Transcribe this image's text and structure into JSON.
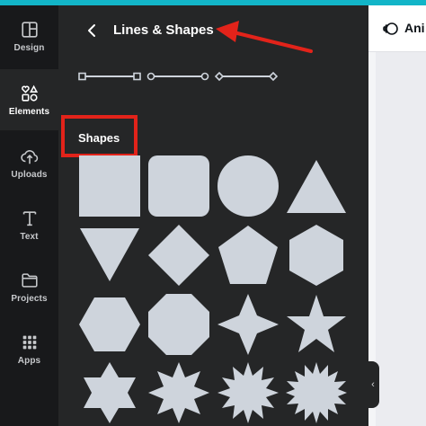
{
  "sidebar": {
    "items": [
      {
        "label": "Design",
        "icon": "layout-icon"
      },
      {
        "label": "Elements",
        "icon": "elements-icon",
        "active": true
      },
      {
        "label": "Uploads",
        "icon": "cloud-upload-icon"
      },
      {
        "label": "Text",
        "icon": "text-icon"
      },
      {
        "label": "Projects",
        "icon": "folder-icon"
      },
      {
        "label": "Apps",
        "icon": "apps-grid-icon"
      }
    ]
  },
  "panel": {
    "title": "Lines & Shapes",
    "shapes_heading": "Shapes",
    "lines": [
      "square-ended line",
      "circle-ended line",
      "diamond-ended line"
    ],
    "shapes": [
      "square",
      "rounded-square",
      "circle",
      "triangle",
      "inverted-triangle",
      "diamond",
      "pentagon",
      "hexagon",
      "hexagon-flat",
      "octagon",
      "four-point-star",
      "five-point-star",
      "six-point-star",
      "eight-point-star",
      "twelve-point-burst",
      "sixteen-point-burst"
    ]
  },
  "toolbar": {
    "animate_label": "Ani"
  },
  "colors": {
    "panel_bg": "#252627",
    "rail_bg": "#18191b",
    "shape_fill": "#ced4dc",
    "highlight": "#e2231a",
    "accent": "#12b5c8"
  }
}
